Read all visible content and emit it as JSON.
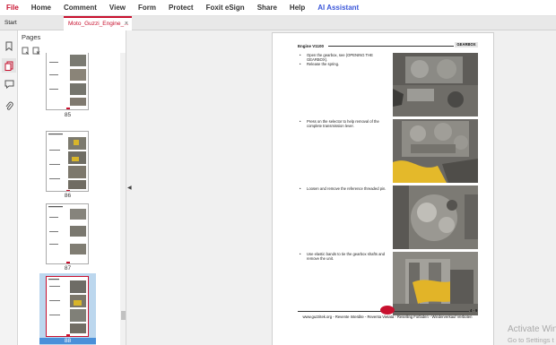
{
  "menu": [
    "File",
    "Home",
    "Comment",
    "View",
    "Form",
    "Protect",
    "Foxit eSign",
    "Share",
    "Help",
    "AI Assistant"
  ],
  "tabs": {
    "start": "Start",
    "document": "Moto_Guzzi_Engine_...",
    "close_glyph": "×"
  },
  "rail": {
    "icons": [
      "bookmark-icon",
      "pages-icon",
      "comment-icon",
      "attachment-icon"
    ]
  },
  "pages_panel": {
    "title": "Pages",
    "tool_icons": [
      "page-thumbnail-options-icon",
      "delete-page-icon"
    ],
    "thumbnails": [
      {
        "label": "85",
        "selected": false
      },
      {
        "label": "86",
        "selected": false
      },
      {
        "label": "87",
        "selected": false
      },
      {
        "label": "88",
        "selected": true
      }
    ]
  },
  "document_page": {
    "header_left": "Engine V1100",
    "header_right": "GEARBOX",
    "steps": [
      {
        "lines": [
          "Open the gearbox, see (OPENING THE GEARBOX).",
          "Release the spring."
        ]
      },
      {
        "lines": [
          "Press on the selector to help removal of the complete transmission lever."
        ]
      },
      {
        "lines": [
          "Loosen and remove the reference threaded pin."
        ]
      },
      {
        "lines": [
          "Use elastic bands to tie the gearbox shafts and remove the unit."
        ]
      }
    ],
    "page_number": "4 - 9",
    "footer": "www.guzzitek.org - Revente Interdite - Reventa Vietata - Reselling Forbiden - Wiederverkauf Verboten"
  },
  "watermark": {
    "line1": "Activate Win",
    "line2": "Go to Settings t"
  },
  "colors": {
    "accent": "#c8102e",
    "ai": "#3b57d9",
    "selection": "#bcd7ee"
  }
}
